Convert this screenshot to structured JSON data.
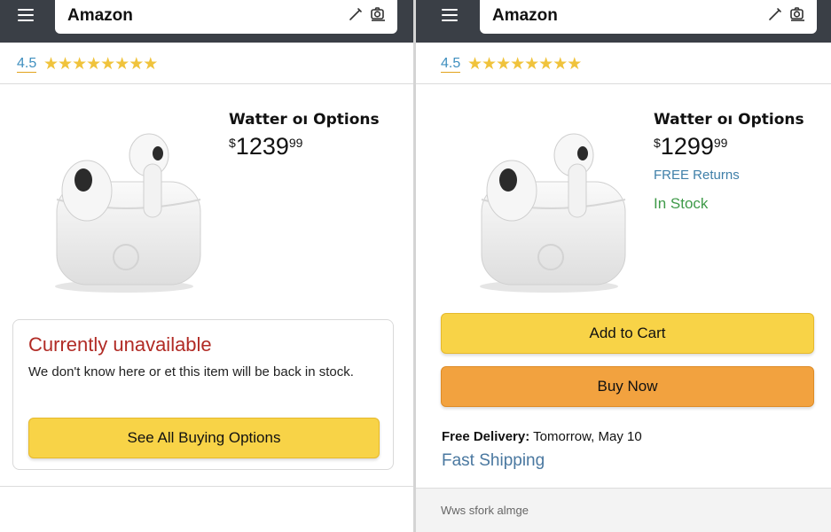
{
  "left": {
    "header": {
      "brand": "Amazon"
    },
    "rating": {
      "value": "4.5",
      "stars": "★★★★★★★★"
    },
    "product": {
      "title": "Watter oı Options",
      "price_currency": "$",
      "price_whole": "1239",
      "price_cents": "99"
    },
    "availability": {
      "title": "Currently unavailable",
      "message": "We don't know here or et this item will be back in stock.",
      "button": "See All Buying Options"
    }
  },
  "right": {
    "header": {
      "brand": "Amazon"
    },
    "rating": {
      "value": "4.5",
      "stars": "★★★★★★★★"
    },
    "product": {
      "title": "Watter oı Options",
      "price_currency": "$",
      "price_whole": "1299",
      "price_cents": "99",
      "free_returns": "FREE Returns",
      "in_stock": "In Stock"
    },
    "buttons": {
      "add_to_cart": "Add to Cart",
      "buy_now": "Buy Now"
    },
    "delivery": {
      "label": "Free Delivery:",
      "date": "Tomorrow, May 10"
    },
    "fast_shipping": "Fast Shipping",
    "footer_text": "Wws sfork almge"
  },
  "colors": {
    "header_bg": "#3a3f46",
    "star": "#f0c33c",
    "unavailable_red": "#b12b25",
    "in_stock_green": "#3f9a49",
    "link_blue": "#3f7fa8",
    "button_yellow": "#f8d347",
    "button_orange": "#f2a23f"
  },
  "icons": [
    "menu-icon",
    "edit-pen-icon",
    "camera-search-icon",
    "star-icon"
  ]
}
